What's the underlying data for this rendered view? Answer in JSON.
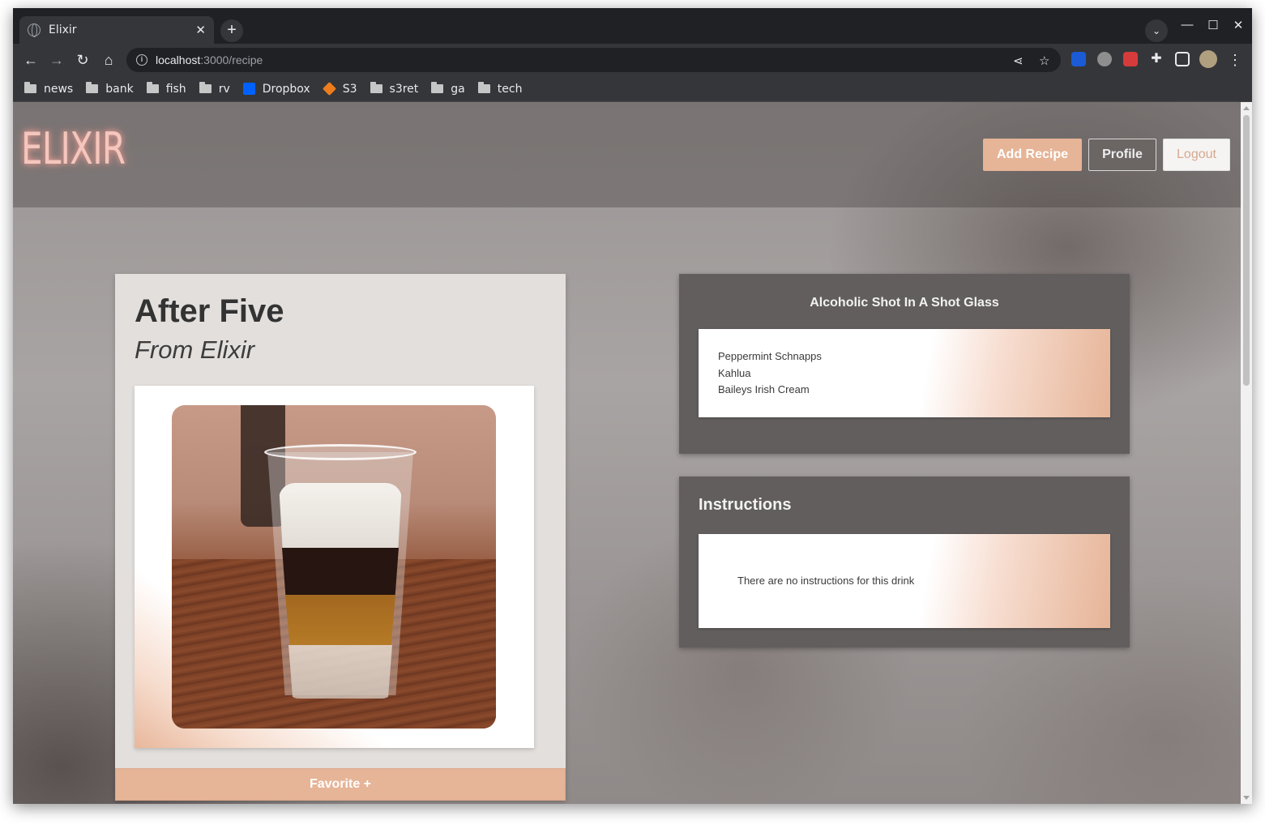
{
  "browser": {
    "tab_title": "Elixir",
    "tab_close": "✕",
    "new_tab": "+",
    "url_host": "localhost",
    "url_path": ":3000/recipe",
    "bookmarks": [
      "news",
      "bank",
      "fish",
      "rv",
      "Dropbox",
      "S3",
      "s3ret",
      "ga",
      "tech"
    ]
  },
  "site": {
    "logo": "ELIXIR",
    "nav": {
      "add_recipe": "Add Recipe",
      "profile": "Profile",
      "logout": "Logout"
    }
  },
  "recipe": {
    "name": "After Five",
    "source": "From Elixir",
    "favorite_label": "Favorite +",
    "glass_type": "Alcoholic Shot In A Shot Glass",
    "ingredients": [
      "Peppermint Schnapps",
      "Kahlua",
      "Baileys Irish Cream"
    ],
    "instructions_title": "Instructions",
    "instructions_text": "There are no instructions for this drink"
  },
  "colors": {
    "accent": "#e6b497",
    "panel": "#625e5d",
    "card": "#e3dfdd"
  }
}
